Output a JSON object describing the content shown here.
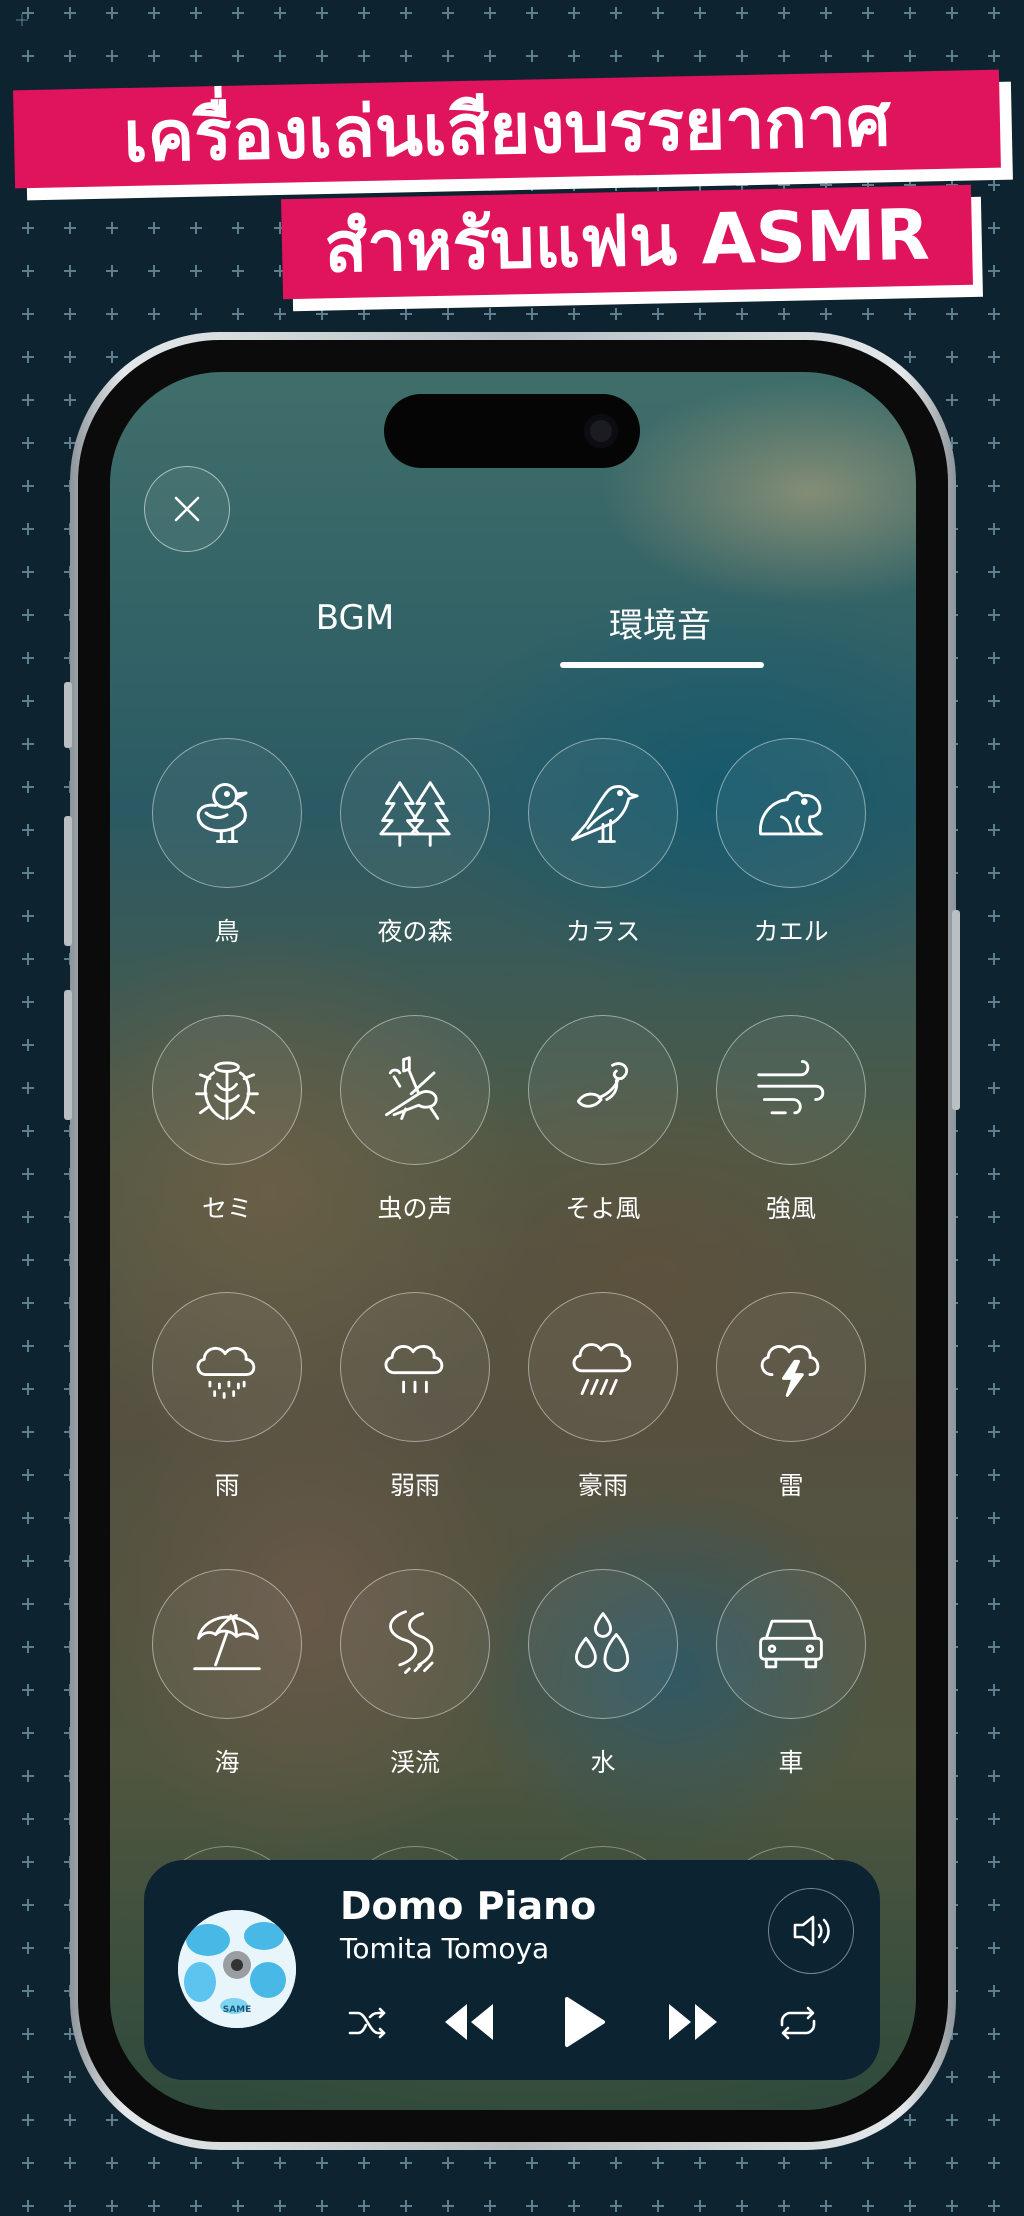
{
  "headline": {
    "line1": "เครื่องเล่นเสียงบรรยากาศ",
    "line2": "สำหรับแฟน ASMR"
  },
  "tabs": [
    {
      "label": "BGM",
      "active": false
    },
    {
      "label": "環境音",
      "active": true
    }
  ],
  "sounds": [
    {
      "label": "鳥",
      "icon": "bird-icon"
    },
    {
      "label": "夜の森",
      "icon": "forest-icon"
    },
    {
      "label": "カラス",
      "icon": "crow-icon"
    },
    {
      "label": "カエル",
      "icon": "frog-icon"
    },
    {
      "label": "セミ",
      "icon": "cicada-icon"
    },
    {
      "label": "虫の声",
      "icon": "cricket-icon"
    },
    {
      "label": "そよ風",
      "icon": "breeze-icon"
    },
    {
      "label": "強風",
      "icon": "strong-wind-icon"
    },
    {
      "label": "雨",
      "icon": "rain-icon"
    },
    {
      "label": "弱雨",
      "icon": "light-rain-icon"
    },
    {
      "label": "豪雨",
      "icon": "heavy-rain-icon"
    },
    {
      "label": "雷",
      "icon": "thunder-icon"
    },
    {
      "label": "海",
      "icon": "beach-umbrella-icon"
    },
    {
      "label": "渓流",
      "icon": "stream-icon"
    },
    {
      "label": "水",
      "icon": "water-drops-icon"
    },
    {
      "label": "車",
      "icon": "car-icon"
    }
  ],
  "now_playing": {
    "title": "Domo Piano",
    "artist": "Tomita Tomoya",
    "album_text": "SAME"
  },
  "colors": {
    "background": "#0d2330",
    "banner": "#e0135d",
    "player": "#0c2332"
  }
}
